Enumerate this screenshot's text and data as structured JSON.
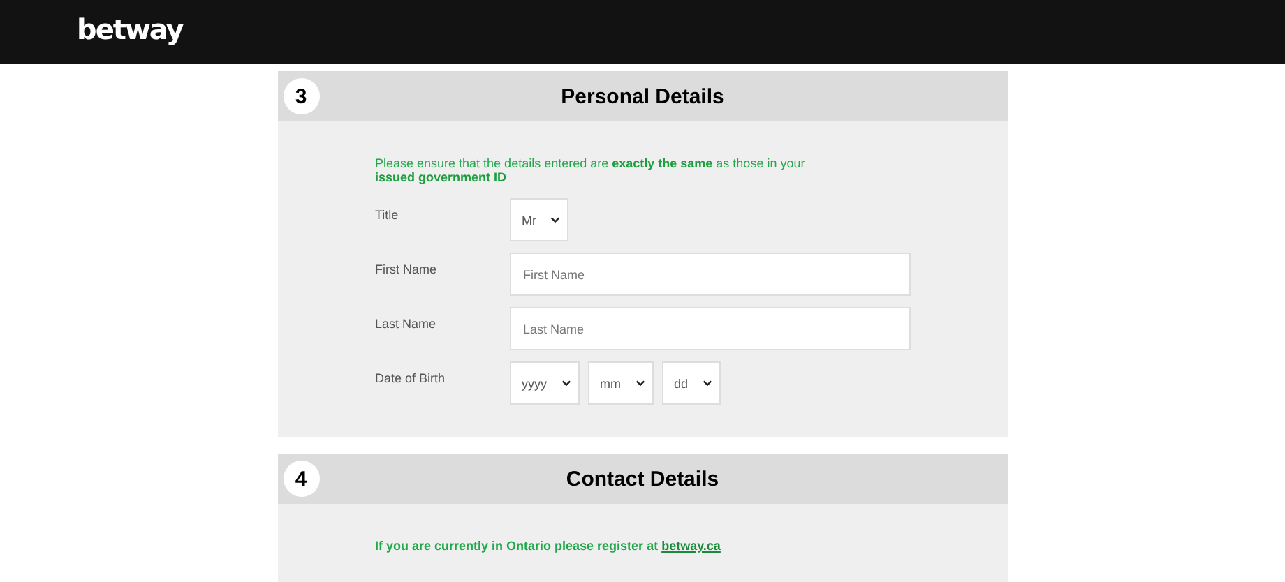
{
  "header": {
    "logo": "betway"
  },
  "sections": [
    {
      "number": "3",
      "title": "Personal Details",
      "kind": "form",
      "intro": "Please ensure that the details entered are **exactly the same** as those in your **issued government ID**",
      "fields": [
        {
          "label": "Title",
          "kind": "select",
          "selects": [
            {
              "value": "Mr"
            }
          ]
        },
        {
          "label": "First Name",
          "kind": "text",
          "placeholder": "First Name"
        },
        {
          "label": "Last Name",
          "kind": "text",
          "placeholder": "Last Name"
        },
        {
          "label": "Date of Birth",
          "kind": "select",
          "selects": [
            {
              "value": "yyyy"
            },
            {
              "value": "mm"
            },
            {
              "value": "dd"
            }
          ]
        }
      ]
    },
    {
      "number": "4",
      "title": "Contact Details",
      "kind": "notice",
      "notice": {
        "text": "If you are currently in Ontario please register at",
        "link": "betway.ca"
      }
    }
  ]
}
